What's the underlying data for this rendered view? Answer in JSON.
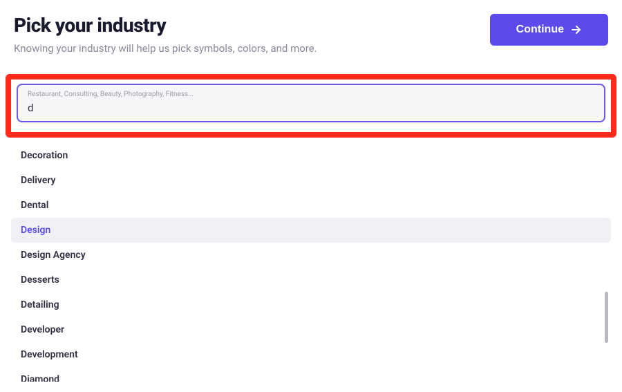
{
  "header": {
    "title": "Pick your industry",
    "subtitle": "Knowing your industry will help us pick symbols, colors, and more.",
    "continue_label": "Continue"
  },
  "search": {
    "placeholder": "Restaurant, Consulting, Beauty, Photography, Fitness...",
    "value": "d"
  },
  "suggestions": [
    {
      "label": "Decoration",
      "highlighted": false
    },
    {
      "label": "Delivery",
      "highlighted": false
    },
    {
      "label": "Dental",
      "highlighted": false
    },
    {
      "label": "Design",
      "highlighted": true
    },
    {
      "label": "Design Agency",
      "highlighted": false
    },
    {
      "label": "Desserts",
      "highlighted": false
    },
    {
      "label": "Detailing",
      "highlighted": false
    },
    {
      "label": "Developer",
      "highlighted": false
    },
    {
      "label": "Development",
      "highlighted": false
    },
    {
      "label": "Diamond",
      "highlighted": false
    }
  ],
  "colors": {
    "primary": "#5b4beb",
    "highlight_border": "#ff2a1a"
  }
}
